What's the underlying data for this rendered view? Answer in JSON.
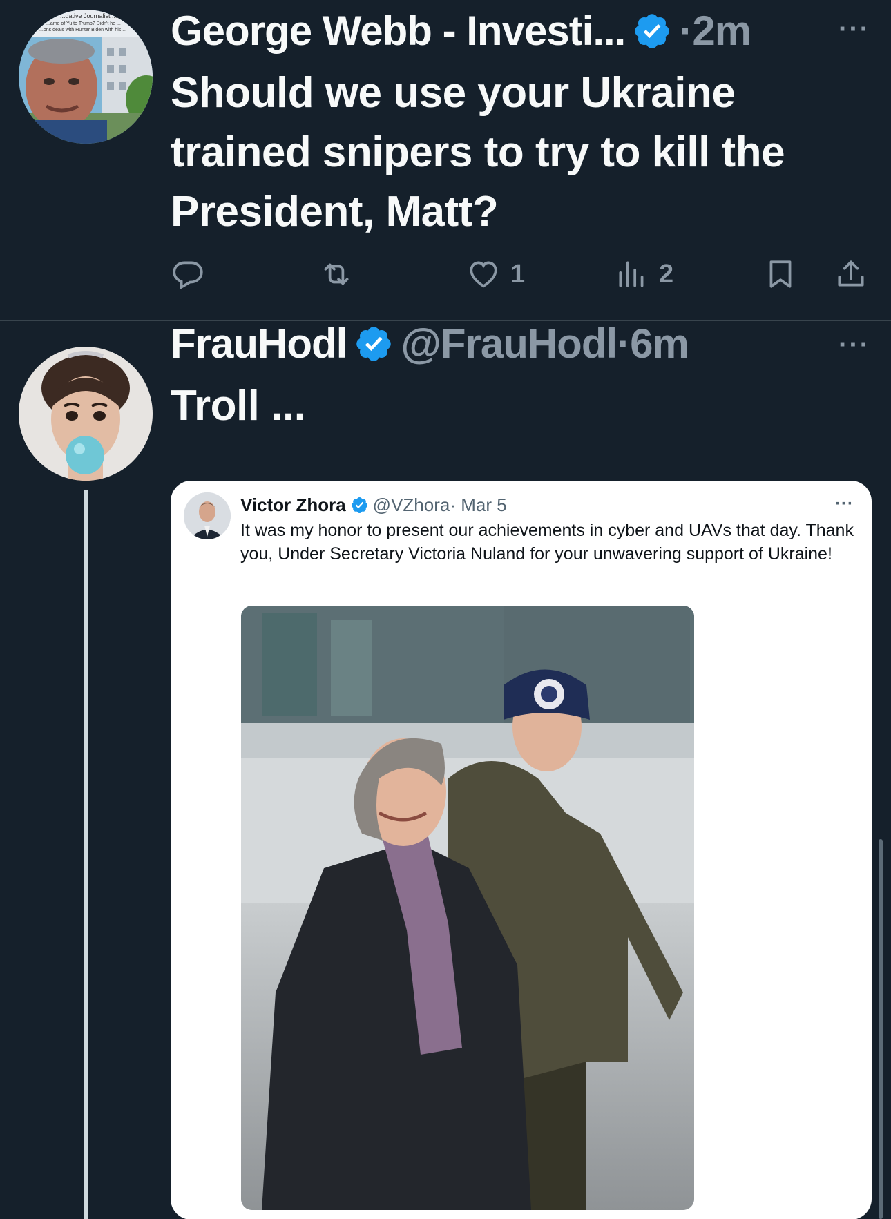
{
  "tweets": [
    {
      "name": "George Webb - Investi...",
      "meta": "·2m",
      "text": "Should we use your Ukraine trained snipers to try to kill the President, Matt?",
      "avatar_caption": [
        "...gative Journalist ...",
        "...ame of Yu to Trump? Didn't he ...",
        "...ons deals with Hunter Biden with his ..."
      ],
      "actions": {
        "reply_icon": "reply-icon",
        "retweet_icon": "retweet-icon",
        "likes": "1",
        "views": "2"
      }
    },
    {
      "name": "FrauHodl",
      "handle": "@FrauHodl",
      "meta": "·6m",
      "text": "Troll ...",
      "quote": {
        "name": "Victor Zhora",
        "handle": "@VZhora",
        "meta": " · Mar 5",
        "text": "It was my honor to present our achievements in cyber and UAVs that day. Thank you, Under Secretary Victoria Nuland for your unwavering support of Ukraine!"
      }
    }
  ],
  "more_label": "···",
  "colors": {
    "background": "#15202b",
    "text": "#f7f9f9",
    "secondary": "#8b98a5",
    "verified": "#1d9bf0",
    "divider": "#38444d"
  }
}
